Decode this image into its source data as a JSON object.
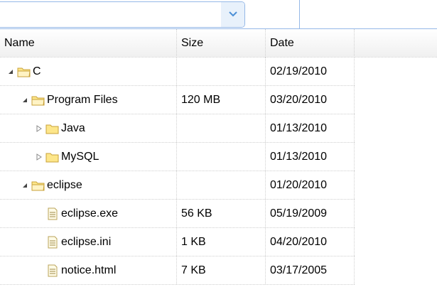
{
  "combo": {
    "value": "",
    "arrow_icon": "chevron-down-icon"
  },
  "columns": {
    "name": "Name",
    "size": "Size",
    "date": "Date"
  },
  "rows": [
    {
      "name": "C",
      "size": "",
      "date": "02/19/2010",
      "depth": 0,
      "type": "folder",
      "state": "expanded"
    },
    {
      "name": "Program Files",
      "size": "120 MB",
      "date": "03/20/2010",
      "depth": 1,
      "type": "folder",
      "state": "expanded"
    },
    {
      "name": "Java",
      "size": "",
      "date": "01/13/2010",
      "depth": 2,
      "type": "folder",
      "state": "collapsed"
    },
    {
      "name": "MySQL",
      "size": "",
      "date": "01/13/2010",
      "depth": 2,
      "type": "folder",
      "state": "collapsed"
    },
    {
      "name": "eclipse",
      "size": "",
      "date": "01/20/2010",
      "depth": 1,
      "type": "folder",
      "state": "expanded"
    },
    {
      "name": "eclipse.exe",
      "size": "56 KB",
      "date": "05/19/2009",
      "depth": 2,
      "type": "file",
      "state": "leaf"
    },
    {
      "name": "eclipse.ini",
      "size": "1 KB",
      "date": "04/20/2010",
      "depth": 2,
      "type": "file",
      "state": "leaf"
    },
    {
      "name": "notice.html",
      "size": "7 KB",
      "date": "03/17/2005",
      "depth": 2,
      "type": "file",
      "state": "leaf"
    }
  ],
  "colors": {
    "border": "#95b8e7",
    "arrow_bg": "#e8f1fb",
    "folder_fill": "#fde68a",
    "folder_stroke": "#c8a23a"
  }
}
